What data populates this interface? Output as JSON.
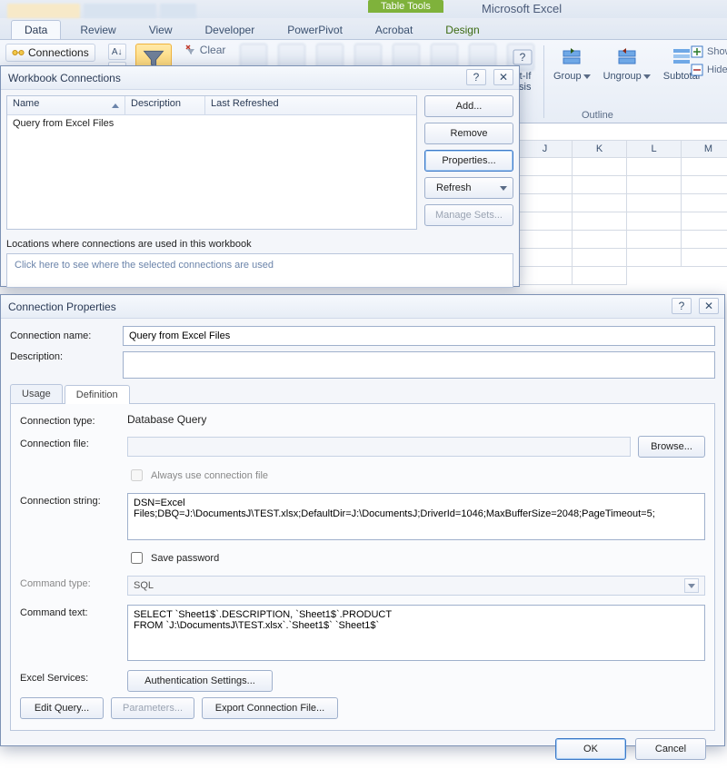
{
  "app": {
    "title": "Microsoft Excel",
    "context_tab_group": "Table Tools"
  },
  "ribbon": {
    "tabs": [
      "Data",
      "Review",
      "View",
      "Developer",
      "PowerPivot",
      "Acrobat",
      "Design"
    ],
    "active_index": 0,
    "connections_btn": "Connections",
    "clear_btn": "Clear",
    "whatif_label": "at-If\nysis",
    "group_btns": {
      "group": "Group",
      "ungroup": "Ungroup",
      "subtotal": "Subtotal"
    },
    "outline_label": "Outline",
    "side": {
      "show_detail": "Show De",
      "hide_detail": "Hide De"
    }
  },
  "grid": {
    "columns": [
      "J",
      "K",
      "L",
      "M"
    ]
  },
  "wc": {
    "title": "Workbook Connections",
    "cols": {
      "name": "Name",
      "desc": "Description",
      "last": "Last Refreshed"
    },
    "rows": [
      {
        "name": "Query from Excel Files"
      }
    ],
    "buttons": {
      "add": "Add...",
      "remove": "Remove",
      "props": "Properties...",
      "refresh": "Refresh",
      "manage": "Manage Sets..."
    },
    "loc_label": "Locations where connections are used in this workbook",
    "loc_hint": "Click here to see where the selected connections are used"
  },
  "cp": {
    "title": "Connection Properties",
    "labels": {
      "conn_name": "Connection name:",
      "desc": "Description:",
      "conn_type": "Connection type:",
      "conn_file": "Connection file:",
      "always_use": "Always use connection file",
      "conn_string": "Connection string:",
      "save_pw": "Save password",
      "cmd_type": "Command type:",
      "cmd_text": "Command text:",
      "excel_svc": "Excel Services:"
    },
    "values": {
      "conn_name": "Query from Excel Files",
      "desc": "",
      "conn_type": "Database Query",
      "conn_file": "",
      "conn_string": "DSN=Excel Files;DBQ=J:\\DocumentsJ\\TEST.xlsx;DefaultDir=J:\\DocumentsJ;DriverId=1046;MaxBufferSize=2048;PageTimeout=5;",
      "cmd_type": "SQL",
      "cmd_text": "SELECT `Sheet1$`.DESCRIPTION, `Sheet1$`.PRODUCT\nFROM `J:\\DocumentsJ\\TEST.xlsx`.`Sheet1$` `Sheet1$`"
    },
    "tabs": {
      "usage": "Usage",
      "definition": "Definition"
    },
    "buttons": {
      "browse": "Browse...",
      "auth": "Authentication Settings...",
      "edit_query": "Edit Query...",
      "params": "Parameters...",
      "export": "Export Connection File...",
      "ok": "OK",
      "cancel": "Cancel"
    }
  }
}
